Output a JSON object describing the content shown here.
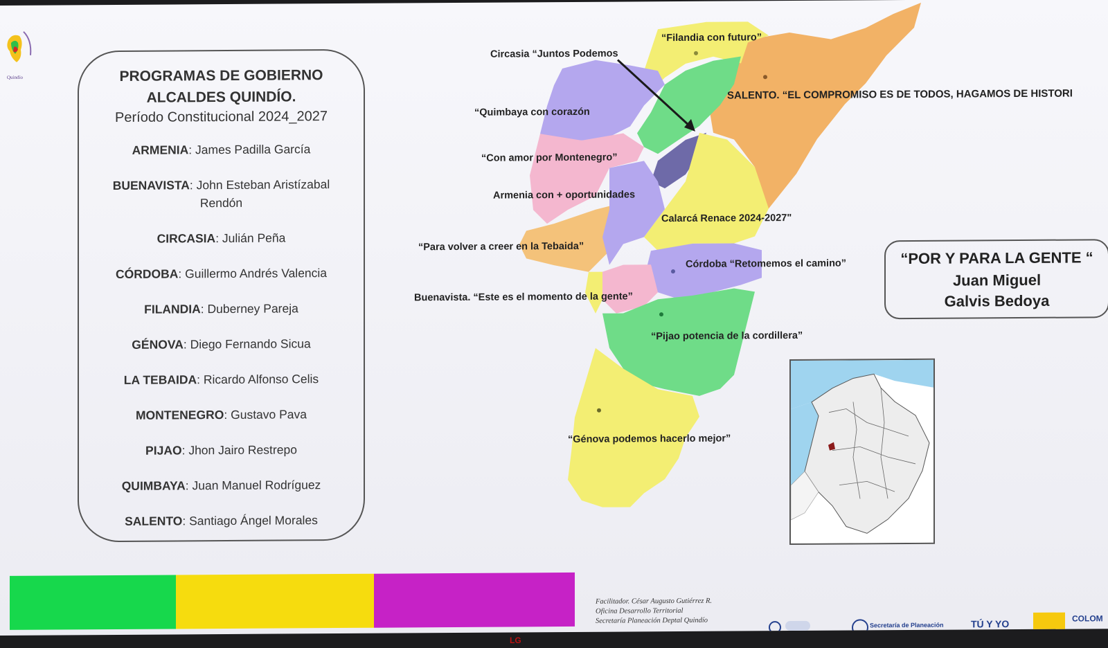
{
  "panel": {
    "title_line1": "PROGRAMAS DE GOBIERNO",
    "title_line2": "ALCALDES QUINDÍO.",
    "subtitle": "Período Constitucional 2024_2027",
    "officials": [
      {
        "municipality": "ARMENIA",
        "mayor": "James Padilla García"
      },
      {
        "municipality": "BUENAVISTA",
        "mayor": "John Esteban Aristízabal Rendón"
      },
      {
        "municipality": "CIRCASIA",
        "mayor": "Julián Peña"
      },
      {
        "municipality": "CÓRDOBA",
        "mayor": "Guillermo Andrés Valencia"
      },
      {
        "municipality": "FILANDIA",
        "mayor": "Duberney Pareja"
      },
      {
        "municipality": "GÉNOVA",
        "mayor": "Diego Fernando Sicua"
      },
      {
        "municipality": "LA TEBAIDA",
        "mayor": "Ricardo Alfonso Celis"
      },
      {
        "municipality": "MONTENEGRO",
        "mayor": "Gustavo Pava"
      },
      {
        "municipality": "PIJAO",
        "mayor": "Jhon Jairo Restrepo"
      },
      {
        "municipality": "QUIMBAYA",
        "mayor": "Juan Manuel Rodríguez"
      },
      {
        "municipality": "SALENTO",
        "mayor": "Santiago Ángel Morales"
      }
    ]
  },
  "map_labels": {
    "filandia": "“Filandia con futuro”",
    "circasia": "Circasia “Juntos Podemos",
    "salento": "SALENTO. “EL COMPROMISO ES DE TODOS, HAGAMOS DE HISTORI",
    "quimbaya": "“Quimbaya con corazón",
    "montenegro": "“Con amor por Montenegro”",
    "armenia": "Armenia con + oportunidades",
    "calarca": "Calarcá Renace 2024-2027\"",
    "tebaida": "“Para volver a creer en la Tebaida”",
    "cordoba": "Córdoba “Retomemos el camino”",
    "buenavista": "Buenavista. “Este es el momento de la gente”",
    "pijao": "“Pijao potencia de la cordillera”",
    "genova": "“Génova podemos hacerlo mejor”"
  },
  "slogan": {
    "line1": "“POR Y PARA LA GENTE “",
    "line2": "Juan Miguel",
    "line3": "Galvis Bedoya"
  },
  "credits": {
    "line1": "Facilitador. César Augusto Gutiérrez R.",
    "line2": "Oficina Desarrollo Territorial",
    "line3": "Secretaría Planeación Deptal Quindío"
  },
  "footer": {
    "planeacion": "Secretaría de Planeación",
    "tu_yo": "TÚ Y YO",
    "colombia": "COLOM"
  },
  "logo_text": "Quindío",
  "tv_brand": "LG",
  "colors": {
    "band_green": "#17d84c",
    "band_yellow": "#f6dc0e",
    "band_purple": "#c622c6"
  }
}
